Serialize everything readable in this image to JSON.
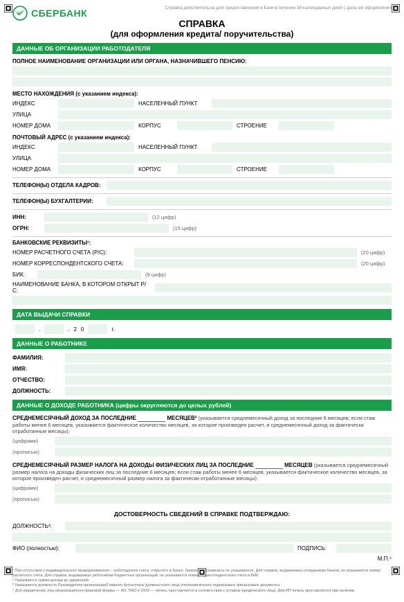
{
  "brand": "СБЕРБАНК",
  "validity_note": "Справка действительна для предоставления в Банк в течение 30 календарных дней с даты её оформления",
  "title": "СПРАВКА",
  "subtitle": "(для оформления кредита/ поручительства)",
  "section_org": "ДАННЫЕ ОБ ОРГАНИЗАЦИИ РАБОТОДАТЕЛЯ",
  "org": {
    "full_name_label": "ПОЛНОЕ НАИМЕНОВАНИЕ ОРГАНИЗАЦИИ ИЛИ ОРГАНА, НАЗНАЧИВШЕГО ПЕНСИЮ:",
    "location_label": "МЕСТО НАХОЖДЕНИЯ (с указанием индекса):",
    "post_label": "ПОЧТОВЫЙ АДРЕС (с указанием индекса):",
    "idx": "ИНДЕКС",
    "settlement": "НАСЕЛЕННЫЙ ПУНКТ",
    "street": "УЛИЦА",
    "house": "НОМЕР ДОМА",
    "korpus": "КОРПУС",
    "building": "СТРОЕНИЕ",
    "hr_phone": "ТЕЛЕФОН(Ы) ОТДЕЛА КАДРОВ:",
    "acc_phone": "ТЕЛЕФОН(Ы) БУХГАЛТЕРИИ:",
    "inn": "ИНН:",
    "inn_hint": "(12 цифр)",
    "ogrn": "ОГРН:",
    "ogrn_hint": "(15 цифр)",
    "bank_req": "БАНКОВСКИЕ РЕКВИЗИТЫ¹:",
    "rs": "НОМЕР РАСЧЕТНОГО СЧЕТА (Р/С):",
    "rs_hint": "(20 цифр)",
    "ks": "НОМЕР КОРРЕСПОНДЕНТСКОГО СЧЕТА:",
    "ks_hint": "(20 цифр)",
    "bik": "БИК:",
    "bik_hint": "(9 цифр)",
    "bank_name": "НАИМЕНОВАНИЕ БАНКА, В КОТОРОМ ОТКРЫТ Р/С:"
  },
  "section_date": "ДАТА ВЫДАЧИ СПРАВКИ",
  "date": {
    "y1": "2",
    "y2": "0",
    "tail": "г."
  },
  "section_employee": "ДАННЫЕ О РАБОТНИКЕ",
  "emp": {
    "surname": "ФАМИЛИЯ:",
    "name": "ИМЯ:",
    "patronymic": "ОТЧЕСТВО:",
    "position": "ДОЛЖНОСТЬ:"
  },
  "section_income": "ДАННЫЕ О ДОХОДЕ РАБОТНИКА (цифры округляются до целых рублей)",
  "income": {
    "avg_income_a": "СРЕДНЕМЕСЯЧНЫЙ ДОХОД ЗА ПОСЛЕДНИЕ",
    "avg_income_b": "МЕСЯЦЕВ²",
    "avg_income_note": "(указывается среднемесячный доход за последние 6 месяцев; если стаж работы менее 6 месяцев, указывается фактическое количество месяцев, за которое произведен расчет, и среднемесячный доход за фактически отработанные месяцы):",
    "digits": "(цифрами)",
    "words": "(прописью)",
    "tax_a": "СРЕДНЕМЕСЯЧНЫЙ РАЗМЕР НАЛОГА НА ДОХОДЫ ФИЗИЧЕСКИХ ЛИЦ ЗА ПОСЛЕДНИЕ",
    "tax_b": "МЕСЯЦЕВ",
    "tax_note": "(указывается среднемесячный размер налога на доходы физических лиц за последние 6 месяцев; если стаж работы менее 6 месяцев, указывается фактическое количество месяцев, за которое произведен расчет, и среднемесячный размер налога за фактически отработанные месяцы):",
    "confirm": "ДОСТОВЕРНОСТЬ СВЕДЕНИЙ В СПРАВКЕ ПОДТВЕРЖДАЮ:",
    "position": "ДОЛЖНОСТЬ³:",
    "fio": "ФИО (полностью):",
    "signature": "ПОДПИСЬ:",
    "mp": "М.П.⁴"
  },
  "footnotes": {
    "f1": "¹ При отсутствии у индивидуального предпринимателя – работодателя счета, открытого в Банке, банковские реквизиты не указываются. Для справок, выдаваемых сотрудникам банков, не указывается номер расчетного счета. Для справок, выдаваемых работникам бюджетных организаций, не указывается номер корреспондентского счета и БИК.",
    "f2": "² Указывается сумма дохода до удержаний.",
    "f3": "³ Указывается должность Руководителя организации/Главного бухгалтера/ должностного лица уполномоченного подписывать финансовые документы.",
    "f4": "⁴ Для юридических лиц организационно-правовой формы — АО, ПАО и ООО — печать проставляется в соответствии с уставом юридического лица. Для ИП печать проставляется при наличии."
  }
}
